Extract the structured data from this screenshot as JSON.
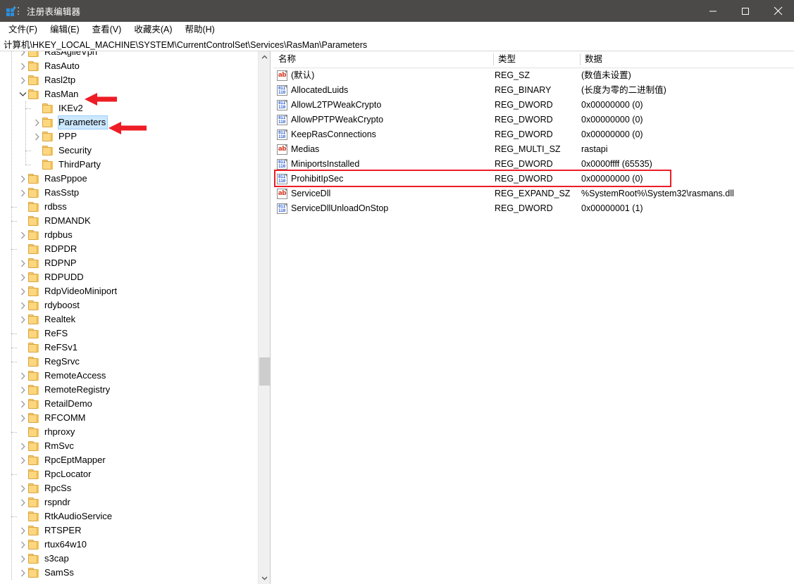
{
  "window": {
    "title": "注册表编辑器",
    "app_icon": "registry-editor-icon",
    "controls": {
      "minimize": "minimize-icon",
      "maximize": "maximize-icon",
      "close": "close-icon"
    }
  },
  "menubar": {
    "items": [
      {
        "label": "文件(F)",
        "name": "menu-file"
      },
      {
        "label": "编辑(E)",
        "name": "menu-edit"
      },
      {
        "label": "查看(V)",
        "name": "menu-view"
      },
      {
        "label": "收藏夹(A)",
        "name": "menu-favorites"
      },
      {
        "label": "帮助(H)",
        "name": "menu-help"
      }
    ]
  },
  "address": {
    "path": "计算机\\HKEY_LOCAL_MACHINE\\SYSTEM\\CurrentControlSet\\Services\\RasMan\\Parameters"
  },
  "tree": {
    "nodes": [
      {
        "label": "RasAgileVpn",
        "depth": 0,
        "expander": "collapsed",
        "selected": false
      },
      {
        "label": "RasAuto",
        "depth": 0,
        "expander": "collapsed",
        "selected": false
      },
      {
        "label": "Rasl2tp",
        "depth": 0,
        "expander": "collapsed",
        "selected": false
      },
      {
        "label": "RasMan",
        "depth": 0,
        "expander": "expanded",
        "selected": false
      },
      {
        "label": "IKEv2",
        "depth": 1,
        "expander": "none",
        "selected": false
      },
      {
        "label": "Parameters",
        "depth": 1,
        "expander": "collapsed",
        "selected": true
      },
      {
        "label": "PPP",
        "depth": 1,
        "expander": "collapsed",
        "selected": false
      },
      {
        "label": "Security",
        "depth": 1,
        "expander": "none",
        "selected": false
      },
      {
        "label": "ThirdParty",
        "depth": 1,
        "expander": "none",
        "selected": false
      },
      {
        "label": "RasPppoe",
        "depth": 0,
        "expander": "collapsed",
        "selected": false
      },
      {
        "label": "RasSstp",
        "depth": 0,
        "expander": "collapsed",
        "selected": false
      },
      {
        "label": "rdbss",
        "depth": 0,
        "expander": "none",
        "selected": false
      },
      {
        "label": "RDMANDK",
        "depth": 0,
        "expander": "none",
        "selected": false
      },
      {
        "label": "rdpbus",
        "depth": 0,
        "expander": "collapsed",
        "selected": false
      },
      {
        "label": "RDPDR",
        "depth": 0,
        "expander": "none",
        "selected": false
      },
      {
        "label": "RDPNP",
        "depth": 0,
        "expander": "collapsed",
        "selected": false
      },
      {
        "label": "RDPUDD",
        "depth": 0,
        "expander": "collapsed",
        "selected": false
      },
      {
        "label": "RdpVideoMiniport",
        "depth": 0,
        "expander": "collapsed",
        "selected": false
      },
      {
        "label": "rdyboost",
        "depth": 0,
        "expander": "collapsed",
        "selected": false
      },
      {
        "label": "Realtek",
        "depth": 0,
        "expander": "collapsed",
        "selected": false
      },
      {
        "label": "ReFS",
        "depth": 0,
        "expander": "none",
        "selected": false
      },
      {
        "label": "ReFSv1",
        "depth": 0,
        "expander": "none",
        "selected": false
      },
      {
        "label": "RegSrvc",
        "depth": 0,
        "expander": "none",
        "selected": false
      },
      {
        "label": "RemoteAccess",
        "depth": 0,
        "expander": "collapsed",
        "selected": false
      },
      {
        "label": "RemoteRegistry",
        "depth": 0,
        "expander": "collapsed",
        "selected": false
      },
      {
        "label": "RetailDemo",
        "depth": 0,
        "expander": "collapsed",
        "selected": false
      },
      {
        "label": "RFCOMM",
        "depth": 0,
        "expander": "collapsed",
        "selected": false
      },
      {
        "label": "rhproxy",
        "depth": 0,
        "expander": "none",
        "selected": false
      },
      {
        "label": "RmSvc",
        "depth": 0,
        "expander": "collapsed",
        "selected": false
      },
      {
        "label": "RpcEptMapper",
        "depth": 0,
        "expander": "collapsed",
        "selected": false
      },
      {
        "label": "RpcLocator",
        "depth": 0,
        "expander": "none",
        "selected": false
      },
      {
        "label": "RpcSs",
        "depth": 0,
        "expander": "collapsed",
        "selected": false
      },
      {
        "label": "rspndr",
        "depth": 0,
        "expander": "collapsed",
        "selected": false
      },
      {
        "label": "RtkAudioService",
        "depth": 0,
        "expander": "none",
        "selected": false
      },
      {
        "label": "RTSPER",
        "depth": 0,
        "expander": "collapsed",
        "selected": false
      },
      {
        "label": "rtux64w10",
        "depth": 0,
        "expander": "collapsed",
        "selected": false
      },
      {
        "label": "s3cap",
        "depth": 0,
        "expander": "collapsed",
        "selected": false
      },
      {
        "label": "SamSs",
        "depth": 0,
        "expander": "collapsed",
        "selected": false
      }
    ],
    "scrollbar": {
      "up": "scroll-up-arrow",
      "down": "scroll-down-arrow"
    }
  },
  "list": {
    "columns": [
      {
        "label": "名称",
        "name": "column-name"
      },
      {
        "label": "类型",
        "name": "column-type"
      },
      {
        "label": "数据",
        "name": "column-data"
      }
    ],
    "rows": [
      {
        "name": "(默认)",
        "type": "REG_SZ",
        "data": "(数值未设置)",
        "icon": "string-value-icon"
      },
      {
        "name": "AllocatedLuids",
        "type": "REG_BINARY",
        "data": "(长度为零的二进制值)",
        "icon": "binary-value-icon"
      },
      {
        "name": "AllowL2TPWeakCrypto",
        "type": "REG_DWORD",
        "data": "0x00000000 (0)",
        "icon": "binary-value-icon"
      },
      {
        "name": "AllowPPTPWeakCrypto",
        "type": "REG_DWORD",
        "data": "0x00000000 (0)",
        "icon": "binary-value-icon"
      },
      {
        "name": "KeepRasConnections",
        "type": "REG_DWORD",
        "data": "0x00000000 (0)",
        "icon": "binary-value-icon"
      },
      {
        "name": "Medias",
        "type": "REG_MULTI_SZ",
        "data": "rastapi",
        "icon": "string-value-icon"
      },
      {
        "name": "MiniportsInstalled",
        "type": "REG_DWORD",
        "data": "0x0000ffff (65535)",
        "icon": "binary-value-icon"
      },
      {
        "name": "ProhibitIpSec",
        "type": "REG_DWORD",
        "data": "0x00000000 (0)",
        "icon": "binary-value-icon"
      },
      {
        "name": "ServiceDll",
        "type": "REG_EXPAND_SZ",
        "data": "%SystemRoot%\\System32\\rasmans.dll",
        "icon": "string-value-icon"
      },
      {
        "name": "ServiceDllUnloadOnStop",
        "type": "REG_DWORD",
        "data": "0x00000001 (1)",
        "icon": "binary-value-icon"
      }
    ]
  },
  "annotations": {
    "highlight_color": "#ee1c25",
    "arrows": [
      {
        "name": "arrow-pointing-rasman",
        "target": "RasMan"
      },
      {
        "name": "arrow-pointing-parameters",
        "target": "Parameters"
      }
    ],
    "boxes": [
      {
        "name": "highlight-box-prohibitipsec",
        "target": "ProhibitIpSec"
      }
    ]
  }
}
